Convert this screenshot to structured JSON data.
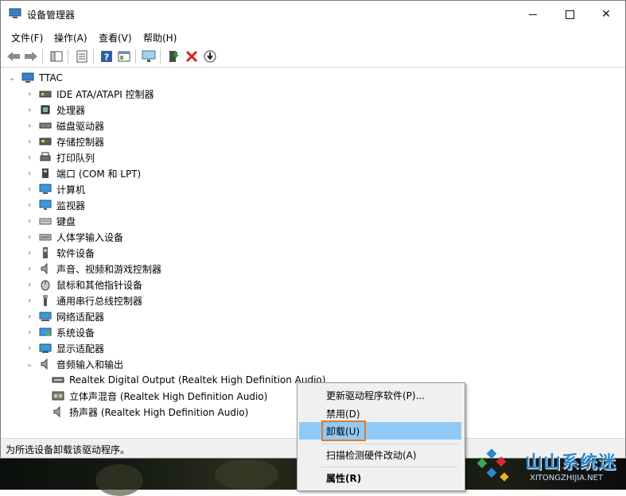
{
  "window": {
    "title": "设备管理器",
    "min_icon": "minimize-icon",
    "max_icon": "maximize-icon",
    "close_label": "✕"
  },
  "menu": [
    "文件(F)",
    "操作(A)",
    "查看(V)",
    "帮助(H)"
  ],
  "toolbar": {
    "icons": [
      "back-arrow-icon",
      "forward-arrow-icon",
      "show-hide-tree-icon",
      "properties-icon",
      "help-icon",
      "view-details-icon",
      "scan-monitor-icon",
      "update-driver-icon",
      "uninstall-x-icon",
      "disable-icon"
    ],
    "colors": {
      "uninstall": "#d81e1e",
      "update": "#1e9c2c"
    }
  },
  "tree": {
    "root": "TTAC",
    "categories": [
      {
        "label": "IDE ATA/ATAPI 控制器",
        "icon": "ide-controller-icon"
      },
      {
        "label": "处理器",
        "icon": "processor-icon"
      },
      {
        "label": "磁盘驱动器",
        "icon": "disk-drive-icon"
      },
      {
        "label": "存储控制器",
        "icon": "storage-controller-icon"
      },
      {
        "label": "打印队列",
        "icon": "printer-icon"
      },
      {
        "label": "端口 (COM 和 LPT)",
        "icon": "port-icon"
      },
      {
        "label": "计算机",
        "icon": "computer-icon"
      },
      {
        "label": "监视器",
        "icon": "monitor-icon"
      },
      {
        "label": "键盘",
        "icon": "keyboard-icon"
      },
      {
        "label": "人体学输入设备",
        "icon": "hid-icon"
      },
      {
        "label": "软件设备",
        "icon": "software-device-icon"
      },
      {
        "label": "声音、视频和游戏控制器",
        "icon": "speaker-icon"
      },
      {
        "label": "鼠标和其他指针设备",
        "icon": "mouse-icon"
      },
      {
        "label": "通用串行总线控制器",
        "icon": "usb-icon"
      },
      {
        "label": "网络适配器",
        "icon": "network-adapter-icon"
      },
      {
        "label": "系统设备",
        "icon": "system-device-icon"
      },
      {
        "label": "显示适配器",
        "icon": "display-adapter-icon"
      },
      {
        "label": "音频输入和输出",
        "icon": "audio-io-icon"
      }
    ],
    "audio_children": [
      {
        "label": "Realtek Digital Output (Realtek High Definition Audio)",
        "icon": "digital-output-icon"
      },
      {
        "label": "立体声混音 (Realtek High Definition Audio)",
        "icon": "stereo-mix-icon"
      },
      {
        "label": "扬声器 (Realtek High Definition Audio)",
        "icon": "speaker-icon"
      }
    ]
  },
  "context_menu": {
    "items": [
      "更新驱动程序软件(P)...",
      "禁用(D)",
      "卸载(U)",
      "扫描检测硬件改动(A)",
      "属性(R)"
    ],
    "highlight_color": "#91c9f7",
    "highlight_border": "#e07a2a"
  },
  "status_bar": "为所选设备卸载该驱动程序。",
  "watermark": {
    "text": "山山系统迷",
    "url": "XITONGZHIJIA.NET"
  }
}
